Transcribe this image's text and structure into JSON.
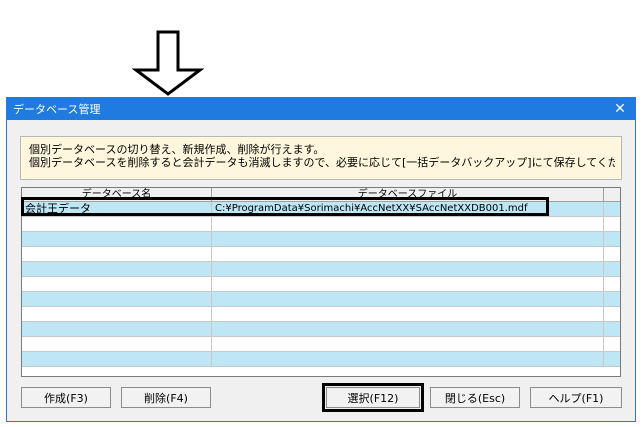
{
  "dialog": {
    "title": "データベース管理",
    "close_glyph": "✕"
  },
  "info": {
    "line1": "個別データベースの切り替え、新規作成、削除が行えます。",
    "line2": "個別データベースを削除すると会計データも消滅しますので、必要に応じて[一括データバックアップ]にて保存してください。"
  },
  "table": {
    "headers": [
      "データベース名",
      "データベースファイル"
    ],
    "rows": [
      [
        "会計王データ",
        "C:¥ProgramData¥Sorimachi¥AccNetXX¥SAccNetXXDB001.mdf"
      ]
    ]
  },
  "buttons": {
    "create": "作成(F3)",
    "delete": "削除(F4)",
    "select": "選択(F12)",
    "close": "閉じる(Esc)",
    "help": "ヘルプ(F1)"
  },
  "colors": {
    "titlebar": "#1f7be0",
    "row_alt": "#bfe6f5",
    "info_bg": "#fff7dd"
  },
  "icons": {
    "arrow": "down-arrow-icon"
  }
}
